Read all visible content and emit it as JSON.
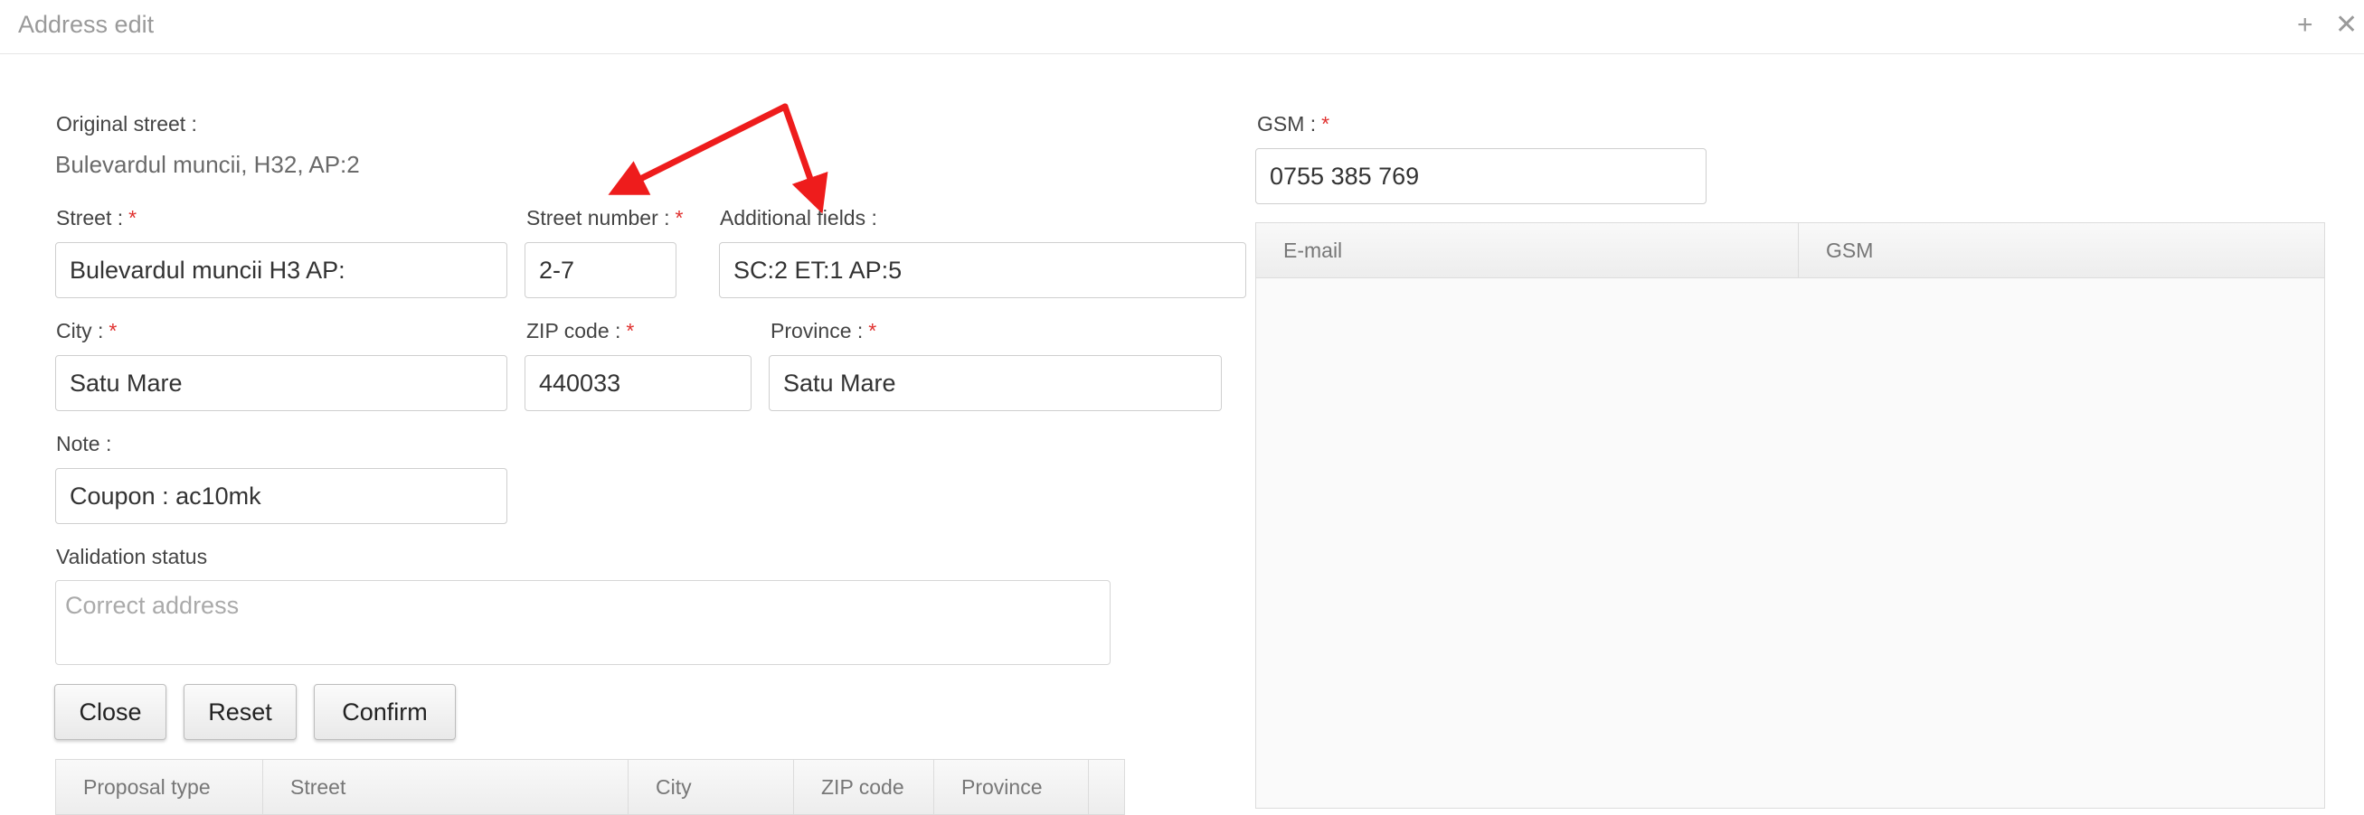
{
  "window": {
    "title": "Address edit"
  },
  "form": {
    "original_street_label": "Original street :",
    "original_street_value": "Bulevardul muncii, H32, AP:2",
    "street_label": "Street :",
    "street_value": "Bulevardul muncii H3 AP:",
    "street_number_label": "Street number :",
    "street_number_value": "2-7",
    "additional_fields_label": "Additional fields :",
    "additional_fields_value": "SC:2 ET:1 AP:5",
    "city_label": "City :",
    "city_value": "Satu Mare",
    "zip_label": "ZIP code :",
    "zip_value": "440033",
    "province_label": "Province :",
    "province_value": "Satu Mare",
    "note_label": "Note :",
    "note_value": "Coupon : ac10mk",
    "validation_label": "Validation status",
    "validation_value": "Correct address",
    "required_mark": "*"
  },
  "buttons": {
    "close": "Close",
    "reset": "Reset",
    "confirm": "Confirm"
  },
  "proposal_table": {
    "columns": [
      "Proposal type",
      "Street",
      "City",
      "ZIP code",
      "Province"
    ]
  },
  "contact": {
    "gsm_label": "GSM :",
    "gsm_value": "0755 385 769",
    "table_columns": [
      "E-mail",
      "GSM"
    ]
  },
  "icons": {
    "maximize": "plus-icon",
    "close": "close-icon",
    "annotation": "red-arrow-annotation"
  },
  "colors": {
    "required": "#e0312f",
    "annotation_arrow": "#ee1c1c"
  }
}
